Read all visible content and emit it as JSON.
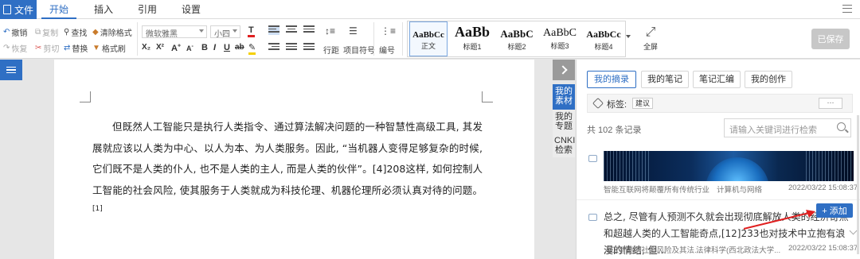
{
  "menu": {
    "file": "文件",
    "tabs": [
      "开始",
      "插入",
      "引用",
      "设置"
    ]
  },
  "ribbon": {
    "undo": "撤销",
    "redo": "恢复",
    "copy": "复制",
    "cut": "剪切",
    "find": "查找",
    "replace": "替换",
    "clear_format": "清除格式",
    "format_painter": "格式刷",
    "font_name": "微软雅黑",
    "font_size": "小四",
    "line_spacing": "行距",
    "bullets": "项目符号",
    "numbering": "编号",
    "styles": [
      {
        "preview": "AaBbCc",
        "label": "正文"
      },
      {
        "preview": "AaBb",
        "label": "标题1"
      },
      {
        "preview": "AaBbC",
        "label": "标题2"
      },
      {
        "preview": "AaBbC",
        "label": "标题3"
      },
      {
        "preview": "AaBbCc",
        "label": "标题4"
      }
    ],
    "fullscreen": "全屏",
    "save": "已保存"
  },
  "document": {
    "paragraph": "但既然人工智能只是执行人类指令、通过算法解决问题的一种智慧性高级工具, 其发展就应该以人类为中心、以人为本、为人类服务。因此, “当机器人变得足够复杂的时候, 它们既不是人类的仆人, 也不是人类的主人, 而是人类的伙伴”。[4]208这样, 如何控制人工智能的社会风险, 使其服务于人类就成为科技伦理、机器伦理所必须认真对待的问题。",
    "footnote": "[1]"
  },
  "side_tabs": [
    "我的素材",
    "我的专题",
    "CNKI检索"
  ],
  "panel": {
    "tabs": [
      "我的摘录",
      "我的笔记",
      "笔记汇编",
      "我的创作"
    ],
    "tag_label": "标签:",
    "tag_chip": "建议",
    "tag_more": "···",
    "count": "共 102 条记录",
    "search_placeholder": "请输入关键词进行检索",
    "entries": [
      {
        "source": "智能互联网将颠覆所有传统行业",
        "category": "计算机与网络",
        "time": "2022/03/22 15:08:37"
      },
      {
        "excerpt": "总之, 尽管有人预测不久就会出现彻底解放人类的经济奇点和超越人类的人工智能奇点,[12]233也对技术中立抱有浪漫的情结, 但...",
        "source": "人工智能的社会风险及其法...",
        "category": "法律科学(西北政法大学...",
        "time": "2022/03/22 15:08:37"
      }
    ],
    "add_button": "+ 添加",
    "more_dots": "···"
  }
}
